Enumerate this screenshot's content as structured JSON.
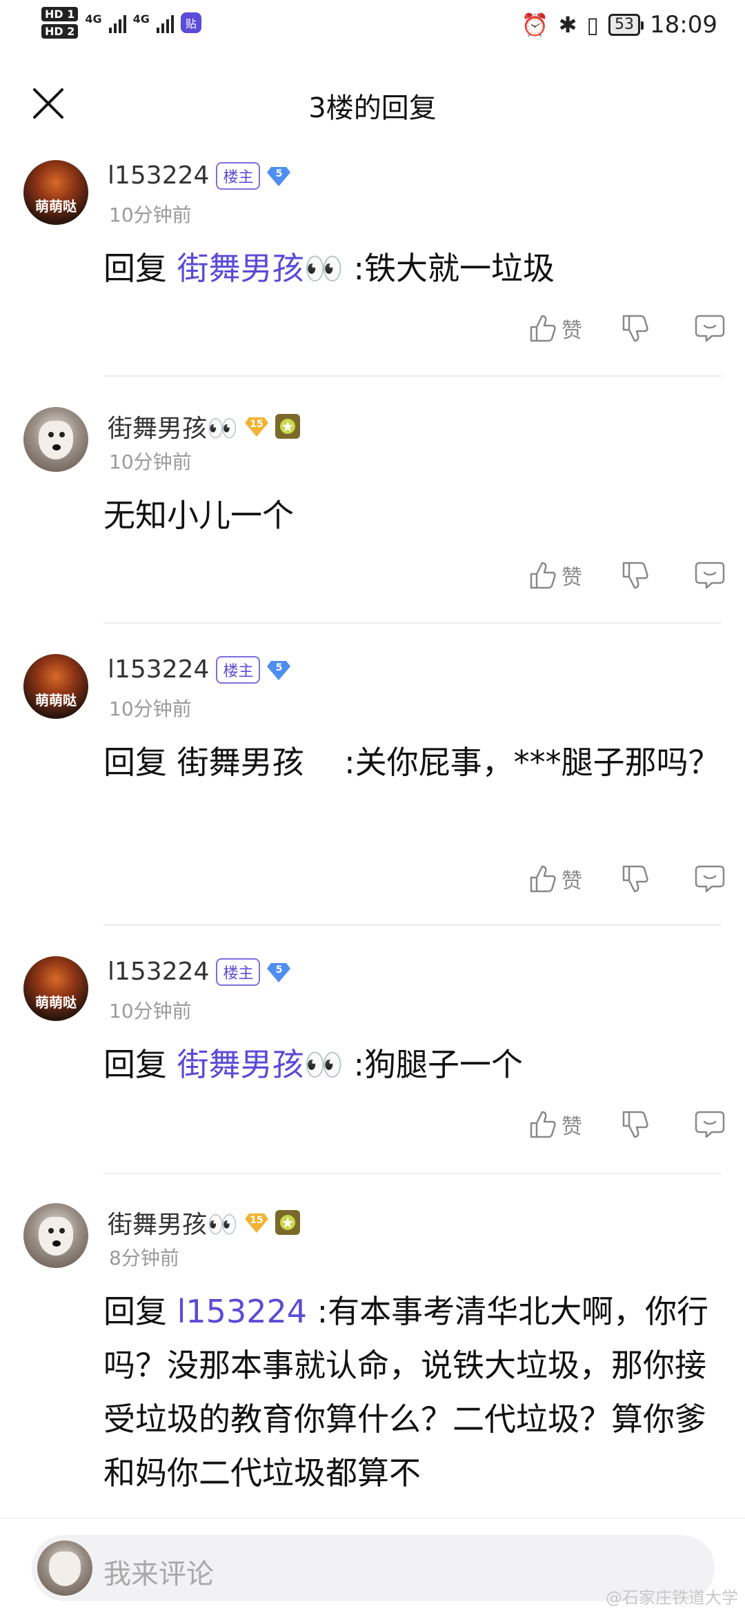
{
  "status": {
    "hd1": "HD 1",
    "hd2": "HD 2",
    "net1": "4G",
    "net2": "4G",
    "app_badge": "贴",
    "battery": "53",
    "time": "18:09"
  },
  "nav": {
    "title": "3楼的回复"
  },
  "comments": [
    {
      "user": "l153224",
      "owner_badge": "楼主",
      "level": "5",
      "time": "10分钟前",
      "reply_prefix": "回复 ",
      "mention": "街舞男孩👀",
      "text": " :铁大就一垃圾",
      "like_label": "赞"
    },
    {
      "user": "街舞男孩👀",
      "level": "15",
      "time": "10分钟前",
      "text": "无知小儿一个",
      "like_label": "赞"
    },
    {
      "user": "l153224",
      "owner_badge": "楼主",
      "level": "5",
      "time": "10分钟前",
      "text": "回复 街舞男孩    :关你屁事，***腿子那吗？",
      "like_label": "赞"
    },
    {
      "user": "l153224",
      "owner_badge": "楼主",
      "level": "5",
      "time": "10分钟前",
      "reply_prefix": "回复 ",
      "mention": "街舞男孩👀",
      "text": " :狗腿子一个",
      "like_label": "赞"
    },
    {
      "user": "街舞男孩👀",
      "level": "15",
      "time": "8分钟前",
      "reply_prefix": "回复 ",
      "mention": "l153224",
      "text": " :有本事考清华北大啊，你行吗？没那本事就认命，说铁大垃圾，那你接受垃圾的教育你算什么？二代垃圾？算你爹和妈你二代垃圾都算不"
    }
  ],
  "avatar_text": "萌萌哒",
  "input": {
    "placeholder": "我来评论"
  },
  "watermark": "@石家庄铁道大学",
  "icons": {
    "close": "close-icon",
    "like": "thumb-up-icon",
    "dislike": "thumb-down-icon",
    "reply": "comment-bubble-icon"
  }
}
